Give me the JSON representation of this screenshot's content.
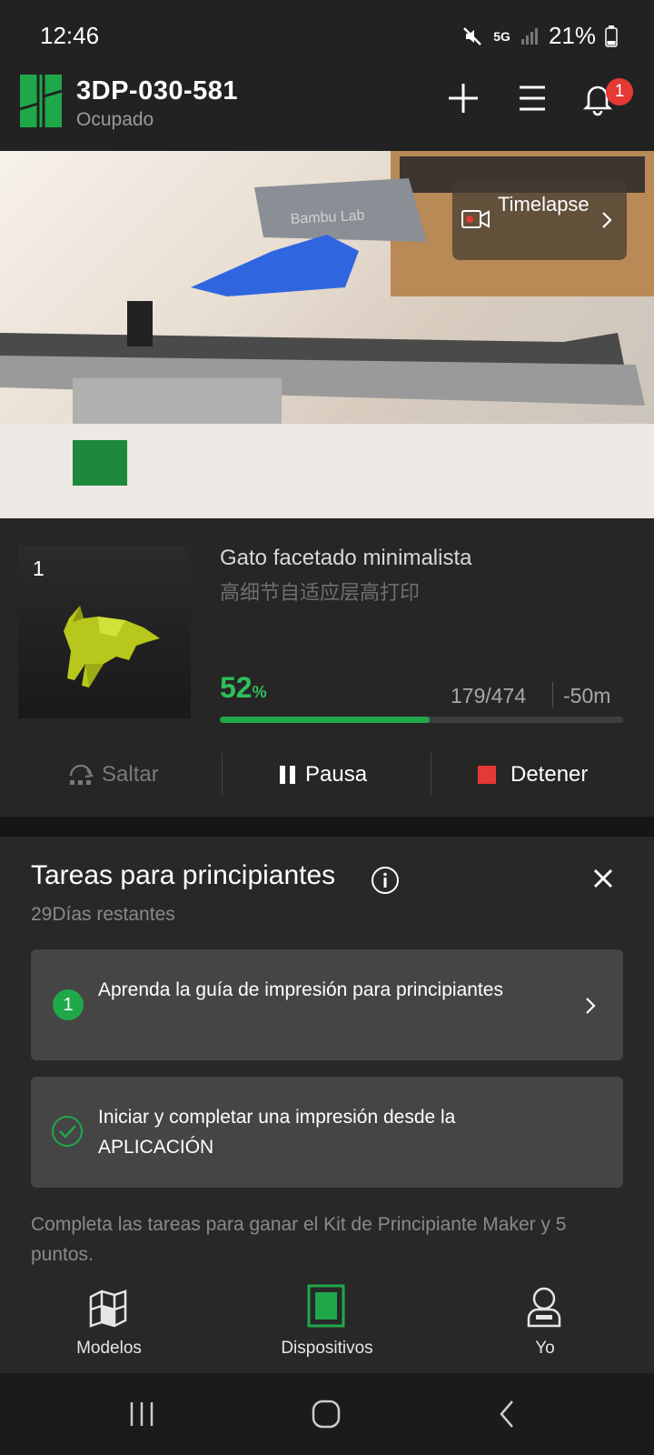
{
  "status_bar": {
    "time": "12:46",
    "network": "5G",
    "battery": "21%"
  },
  "header": {
    "device_name": "3DP-030-581",
    "device_status": "Ocupado",
    "notification_count": "1"
  },
  "camera": {
    "timelapse_label": "Timelapse"
  },
  "job": {
    "plate_number": "1",
    "title": "Gato facetado minimalista",
    "subtitle": "高细节自适应层高打印",
    "progress_value": "52",
    "progress_unit": "%",
    "progress_fraction": 0.52,
    "layers": "179/474",
    "remaining": "-50m",
    "skip_label": "Saltar",
    "pause_label": "Pausa",
    "stop_label": "Detener"
  },
  "tasks": {
    "title": "Tareas para principiantes",
    "remaining": "29Días restantes",
    "items": [
      {
        "step": "1",
        "text": "Aprenda la guía de impresión para principiantes"
      },
      {
        "text": "Iniciar y completar una impresión desde la APLICACIÓN"
      }
    ],
    "footer": "Completa las tareas para ganar el Kit de Principiante Maker y 5 puntos."
  },
  "nav": {
    "items": [
      {
        "label": "Modelos"
      },
      {
        "label": "Dispositivos"
      },
      {
        "label": "Yo"
      }
    ]
  },
  "colors": {
    "accent": "#1fa84a",
    "stop": "#e53935",
    "badge": "#e53935"
  }
}
